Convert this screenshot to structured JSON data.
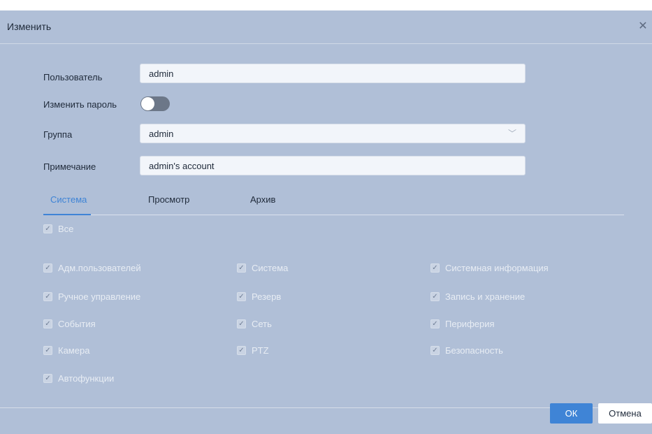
{
  "dialog": {
    "title": "Изменить",
    "close_icon": "close-icon"
  },
  "form": {
    "user_label": "Пользователь",
    "user_value": "admin",
    "change_password_label": "Изменить пароль",
    "change_password_on": false,
    "group_label": "Группа",
    "group_value": "admin",
    "note_label": "Примечание",
    "note_value": "admin's account"
  },
  "tabs": [
    {
      "label": "Система",
      "active": true
    },
    {
      "label": "Просмотр",
      "active": false
    },
    {
      "label": "Архив",
      "active": false
    }
  ],
  "permissions": {
    "all": "Все",
    "col1": [
      "Адм.пользователей",
      "Ручное управление",
      "События",
      "Камера",
      "Автофункции"
    ],
    "col2": [
      "Система",
      "Резерв",
      "Сеть",
      "PTZ"
    ],
    "col3": [
      "Системная информация",
      "Запись и хранение",
      "Периферия",
      "Безопасность"
    ]
  },
  "buttons": {
    "ok": "ОК",
    "cancel": "Отмена"
  },
  "colors": {
    "background": "#b0bfd7",
    "accent": "#3f84d6"
  }
}
